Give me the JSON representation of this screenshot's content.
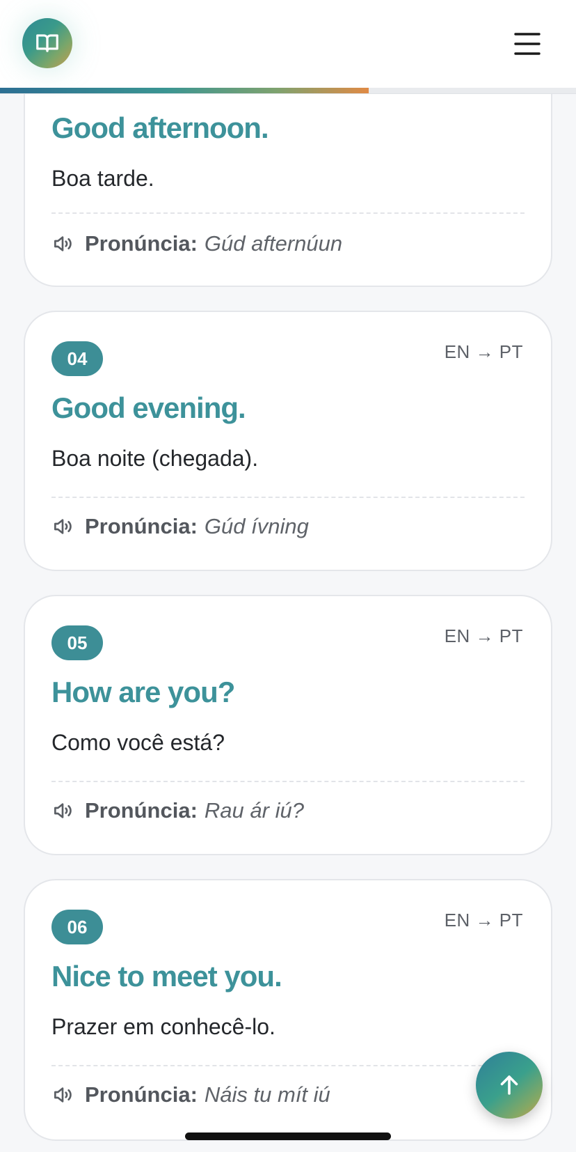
{
  "header": {
    "logo_icon": "open-book-icon",
    "menu_icon": "hamburger-menu-icon",
    "reading_progress": 0.64
  },
  "cards": [
    {
      "number": "",
      "direction": "",
      "phrase": "Good afternoon.",
      "translation": "Boa tarde.",
      "pron_label": "Pronúncia:",
      "pron_value": "Gúd afternúun"
    },
    {
      "number": "04",
      "direction": "EN → PT",
      "phrase": "Good evening.",
      "translation": "Boa noite (chegada).",
      "pron_label": "Pronúncia:",
      "pron_value": "Gúd ívning"
    },
    {
      "number": "05",
      "direction": "EN → PT",
      "phrase": "How are you?",
      "translation": "Como você está?",
      "pron_label": "Pronúncia:",
      "pron_value": "Rau ár iú?"
    },
    {
      "number": "06",
      "direction": "EN → PT",
      "phrase": "Nice to meet you.",
      "translation": "Prazer em conhecê-lo.",
      "pron_label": "Pronúncia:",
      "pron_value": "Náis tu mít iú"
    }
  ],
  "scroll_top_icon": "arrow-up-icon",
  "colors": {
    "accent": "#3d929a",
    "badge": "#3d8e96",
    "progress_gradient_start": "#2d6f93",
    "progress_gradient_end": "#e08a45"
  }
}
